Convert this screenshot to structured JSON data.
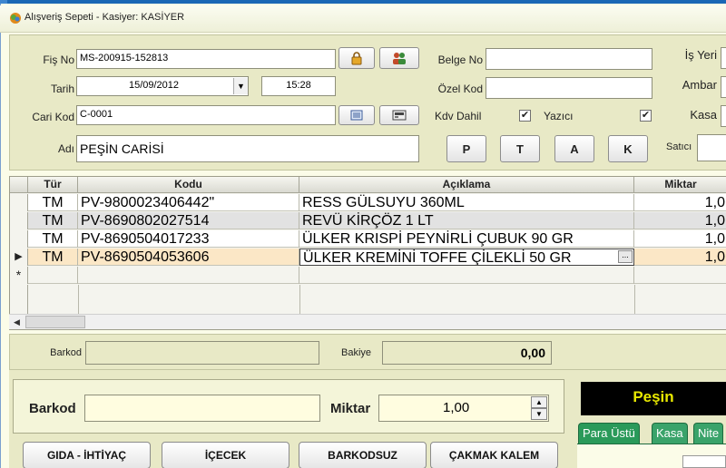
{
  "window": {
    "title": "Alışveriş Sepeti - Kasiyer: KASİYER"
  },
  "header": {
    "fis_no_label": "Fiş No",
    "fis_no_value": "MS-200915-152813",
    "tarih_label": "Tarih",
    "tarih_date": "15/09/2012",
    "tarih_time": "15:28",
    "cari_kod_label": "Cari Kod",
    "cari_kod_value": "C-0001",
    "adi_label": "Adı",
    "adi_value": "PEŞİN CARİSİ",
    "belge_no_label": "Belge No",
    "belge_no_value": "",
    "ozel_kod_label": "Özel Kod",
    "ozel_kod_value": "",
    "kdv_dahil_label": "Kdv Dahil",
    "yazici_label": "Yazıcı",
    "check_mark": "✔",
    "btn_p": "P",
    "btn_t": "T",
    "btn_a": "A",
    "btn_k": "K",
    "is_yeri_label": "İş Yeri",
    "ambar_label": "Ambar",
    "kasa_label": "Kasa",
    "satici_label": "Satıcı"
  },
  "grid": {
    "columns": [
      "Tür",
      "Kodu",
      "Açıklama",
      "Miktar"
    ],
    "rows": [
      {
        "tur": "TM",
        "kodu": "PV-9800023406442\"",
        "aciklama": "RESS GÜLSUYU 360ML",
        "miktar": "1,0"
      },
      {
        "tur": "TM",
        "kodu": "PV-8690802027514",
        "aciklama": "REVÜ KİRÇÖZ 1 LT",
        "miktar": "1,0"
      },
      {
        "tur": "TM",
        "kodu": "PV-8690504017233",
        "aciklama": "ÜLKER KRISPİ  PEYNİRLİ ÇUBUK 90 GR",
        "miktar": "1,0"
      },
      {
        "tur": "TM",
        "kodu": "PV-8690504053606",
        "aciklama": "ÜLKER KREMİNİ TOFFE ÇİLEKLİ 50 GR",
        "miktar": "1,0"
      }
    ],
    "current_row_marker": "▶",
    "new_row_marker": "*",
    "ellipsis": "..."
  },
  "status": {
    "barkod_label": "Barkod",
    "barkod_value": "",
    "bakiye_label": "Bakiye",
    "bakiye_value": "0,00"
  },
  "entry": {
    "barkod_label": "Barkod",
    "barkod_value": "",
    "miktar_label": "Miktar",
    "miktar_value": "1,00"
  },
  "payment": {
    "mode": "Peşin",
    "tabs": [
      "Para Üstü",
      "Kasa",
      "Nite"
    ]
  },
  "categories": [
    "GIDA - İHTİYAÇ",
    "İÇECEK",
    "BARKODSUZ",
    "ÇAKMAK KALEM"
  ],
  "colors": {
    "row_selected": "#fbe7c6",
    "row_alt": "#e2e2e2",
    "entry_field": "#fffde0",
    "pesin_text": "#e8e800",
    "tab_green": "#2a9a5a"
  }
}
